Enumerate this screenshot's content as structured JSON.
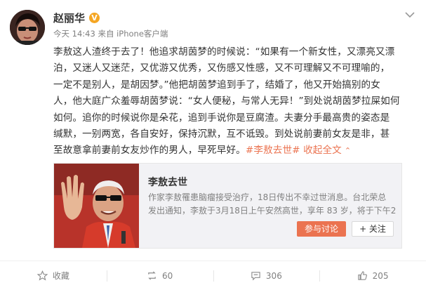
{
  "post": {
    "author": "赵丽华",
    "verified_badge": "V",
    "meta": "今天 14:43 来自 iPhone客户端",
    "text_lines": [
      "李敖这人渣终于去了！他追求胡茵梦的时候说：“如果有一个新女性，又漂亮又漂",
      "泊，又迷人又迷茫，又优游又优秀，又伤感又性感，又不可理解又不可理喻的，",
      "一定不是别人，是胡因梦。”他把胡茵梦追到手了，结婚了，他又开始搞别的女",
      "人，他大庭广众羞辱胡茵梦说：“女人便秘，与常人无异！”到处说胡茵梦拉屎如何",
      "如何。追你的时候说你是朵花，追到手说你是豆腐渣。夫妻分手最高贵的姿态是",
      "缄默，一别两宽，各自安好，保持沉默，互不诋毁。到处说前妻前女友是非，甚",
      "至故意拿前妻前女友炒作的男人，早死早好。"
    ],
    "hashtag": "#李敖去世#",
    "expand_label": "收起全文",
    "expand_chevron": "⌃"
  },
  "card": {
    "title": "李敖去世",
    "desc_lines": [
      "作家李敖罹患脑瘤接受治疗，18日传出不幸过世消息。台北荣总",
      "发出通知，李敖于3月18日上午安然高世，享年 83 岁，将于下午2"
    ],
    "join_label": "参与讨论",
    "follow_label": "+ 关注"
  },
  "actions": {
    "favorite_label": "收藏",
    "repost_count": "60",
    "comment_count": "306",
    "like_count": "205"
  },
  "colors": {
    "accent": "#eb7350",
    "badge": "#f5a623",
    "muted": "#808080"
  },
  "icons": [
    "avatar-photo",
    "more-chevron-icon",
    "star-icon",
    "repost-icon",
    "comment-icon",
    "thumbs-up-icon"
  ]
}
